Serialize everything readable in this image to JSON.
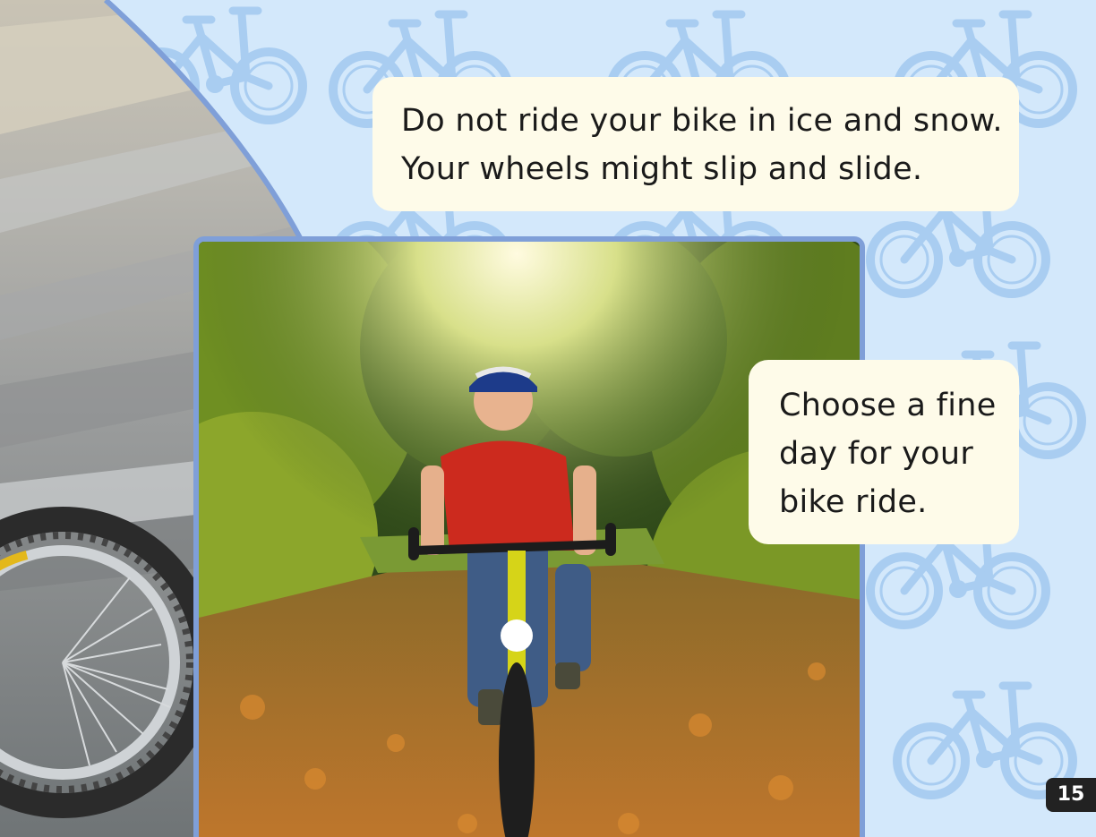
{
  "page": {
    "background_color": "#d3e8fb",
    "pattern_icon": "bicycle-icon",
    "pattern_color": "#a9cdf1"
  },
  "top_text": {
    "lines": [
      "Do not ride your bike in ice and snow.",
      "Your wheels might slip and slide."
    ]
  },
  "side_text": {
    "lines": [
      "Choose a fine",
      "day for your",
      "bike ride."
    ]
  },
  "photos": {
    "left": "icy-road-bicycle-wheel-photo",
    "main": "boy-riding-bike-autumn-path-photo",
    "frame_color": "#7f9fd8"
  },
  "page_number": "15"
}
